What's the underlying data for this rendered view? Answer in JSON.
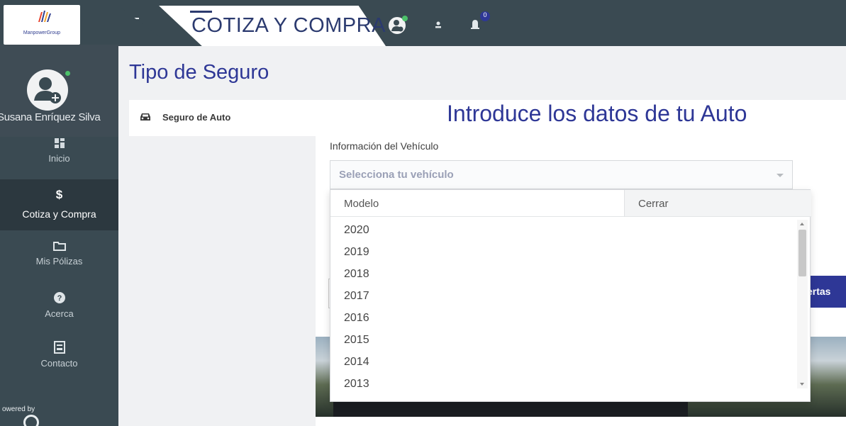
{
  "sidebar": {
    "logo_text": "ManpowerGroup",
    "user_name": "Susana Enríquez Silva",
    "items": [
      {
        "label": "Inicio",
        "icon": "dashboard-icon"
      },
      {
        "label": "Cotiza y Compra",
        "icon": "dollar-icon"
      },
      {
        "label": "Mis Pólizas",
        "icon": "folder-icon"
      },
      {
        "label": "Acerca",
        "icon": "help-icon"
      },
      {
        "label": "Contacto",
        "icon": "contact-card-icon"
      }
    ],
    "powered_by": "owered by"
  },
  "topbar": {
    "title": "COTIZA Y COMPRA",
    "notification_count": "0"
  },
  "main": {
    "page_title": "Tipo de Seguro",
    "insurance_type": "Seguro de Auto",
    "heading": "Introduce los datos de tu Auto",
    "field_label": "Información del Vehículo",
    "select_placeholder": "Selecciona tu vehículo",
    "offers_button": "ertas"
  },
  "dropdown": {
    "model_header": "Modelo",
    "close_label": "Cerrar",
    "options": [
      "2020",
      "2019",
      "2018",
      "2017",
      "2016",
      "2015",
      "2014",
      "2013"
    ]
  },
  "colors": {
    "sidebar_bg": "#3a4a52",
    "accent": "#2e3796",
    "status_online": "#4cc16a"
  }
}
